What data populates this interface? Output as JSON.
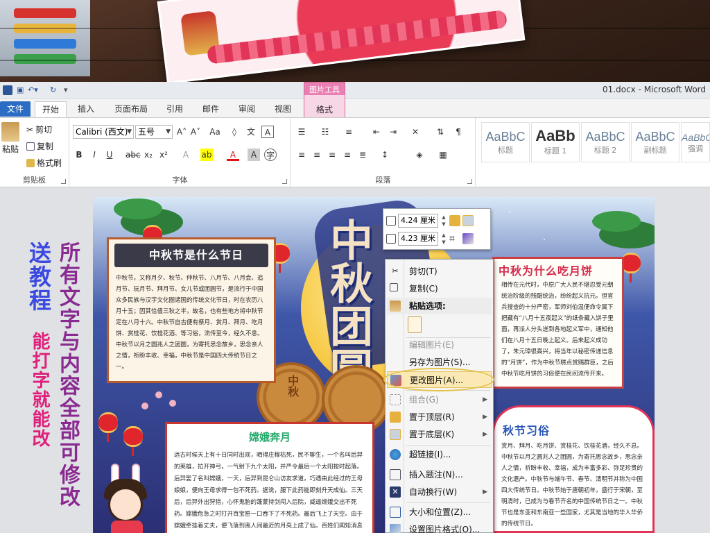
{
  "colors": {
    "word_blue": "#2b6cc4",
    "picture_tools_pink": "#e97fb2",
    "promo_blue": "#3a49e0",
    "promo_pink": "#e0207a",
    "promo_purple": "#8a2a90"
  },
  "window": {
    "title": "01.docx - Microsoft Word"
  },
  "ribbon": {
    "context_tab_title": "图片工具",
    "context_tab_label": "格式",
    "tabs": [
      "文件",
      "开始",
      "插入",
      "页面布局",
      "引用",
      "邮件",
      "审阅",
      "视图"
    ],
    "clipboard": {
      "paste": "粘贴",
      "cut": "剪切",
      "copy": "复制",
      "format_painter": "格式刷",
      "group_label": "剪贴板"
    },
    "font": {
      "family": "Calibri (西文)",
      "size": "五号",
      "group_label": "字体"
    },
    "paragraph": {
      "group_label": "段落"
    },
    "styles": [
      {
        "preview": "AaBbC",
        "name": "标题"
      },
      {
        "preview": "AaBb",
        "name": "标题 1"
      },
      {
        "preview": "AaBbC",
        "name": "标题 2"
      },
      {
        "preview": "AaBbC",
        "name": "副标题"
      },
      {
        "preview": "AaBbC",
        "name": "强调"
      }
    ]
  },
  "promo": {
    "line1": "送教程",
    "line2": "能打字就能改",
    "line3": "所有文字与内容全部可修改"
  },
  "poster": {
    "panel1": {
      "title": "中秋节是什么节日",
      "body": "中秋节，又称月夕、秋节、仲秋节、八月节、八月会、追月节、玩月节、拜月节、女儿节或团圆节，是流行于中国众多民族与汉字文化圈诸国的传统文化节日，时在农历八月十五；因其恰值三秋之半，故名，也有些地方将中秋节定在八月十六。中秋节自古便有祭月、赏月、拜月、吃月饼、赏桂花、饮桂花酒、等习俗，流传至今，经久不息。中秋节以月之圆兆人之团圆，为寄托思念故乡，思念亲人之情，祈盼丰收、幸福，中秋节是中国四大传统节日之一。"
    },
    "panel2": {
      "title": "嫦娥奔月",
      "body": "远古时候天上有十日同时出现，晒得庄稼枯死，民不聊生，一个名叫后羿的英雄，拉开神弓，一气射下九个太阳，并严令最后一个太阳按时起落。后羿娶了名叫嫦娥，一天，后羿到昆仑山访友求道，巧遇由此经过的王母娘娘，便向王母求得一包不死药。据说，服下此药能即刻升天成仙。三天后，后羿外出狩猎，心怀鬼胎的蓬蒙持剑闯入后院，威逼嫦娥交出不死药。嫦娥危急之时打开百宝匣一口吞下了不死药。最后飞上了天空。由于嫦娥牵挂着丈夫，便飞落到离人间最近的月亮上成了仙。百姓们闻知消息后，纷纷在月下摆设香案，向善良的嫦娥祈"
    },
    "panel3": {
      "title": "中秋为什么吃月饼",
      "body": "相传在元代时，中原广大人民不堪忍受元朝统治阶级的残酷统治，纷纷起义抗元。但官兵搜查的十分严密，军师刘伯温便命令属下把藏有“八月十五夜起义”的纸条藏入饼子里面，再派人分头送到各地起义军中，通知他们在八月十五日晚上起义。后来起义成功了，朱元璋很高兴，将当年以秘密传递信息的“月饼”，作为中秋节糕点赏赐群臣，之后中秋节吃月饼的习俗便在民间流传开来。"
    },
    "panel4": {
      "title": "秋节习俗",
      "body": "赏月、拜月、吃月饼、赏桂花、饮桂花酒，经久不息。中秋节以月之圆兆人之团圆，为寄托思念故乡，思念亲人之情，祈盼丰收、幸福，成为丰富多彩、弥足珍贵的文化遗产。中秋节与端午节、春节、清明节并称为中国四大传统节日。中秋节始于唐朝初年，盛行于宋朝，至明清时，已成为与春节齐名的中国传统节日之一。中秋节也是东亚和东南亚一些国家，尤其是当地的华人华侨的传统节日。"
    },
    "title_art": "中秋团圆",
    "mooncake_text": "中秋"
  },
  "size_toolbar": {
    "height": "4.24 厘米",
    "width": "4.23 厘米"
  },
  "context_menu": {
    "cut": "剪切(T)",
    "copy": "复制(C)",
    "paste_options": "粘贴选项:",
    "edit_picture": "编辑图片(E)",
    "save_as_picture": "另存为图片(S)...",
    "change_picture": "更改图片(A)...",
    "group": "组合(G)",
    "bring_to_front": "置于顶层(R)",
    "send_to_back": "置于底层(K)",
    "hyperlink": "超链接(I)...",
    "insert_caption": "插入题注(N)...",
    "wrap_text": "自动换行(W)",
    "size_position": "大小和位置(Z)...",
    "format_picture": "设置图片格式(O)..."
  }
}
